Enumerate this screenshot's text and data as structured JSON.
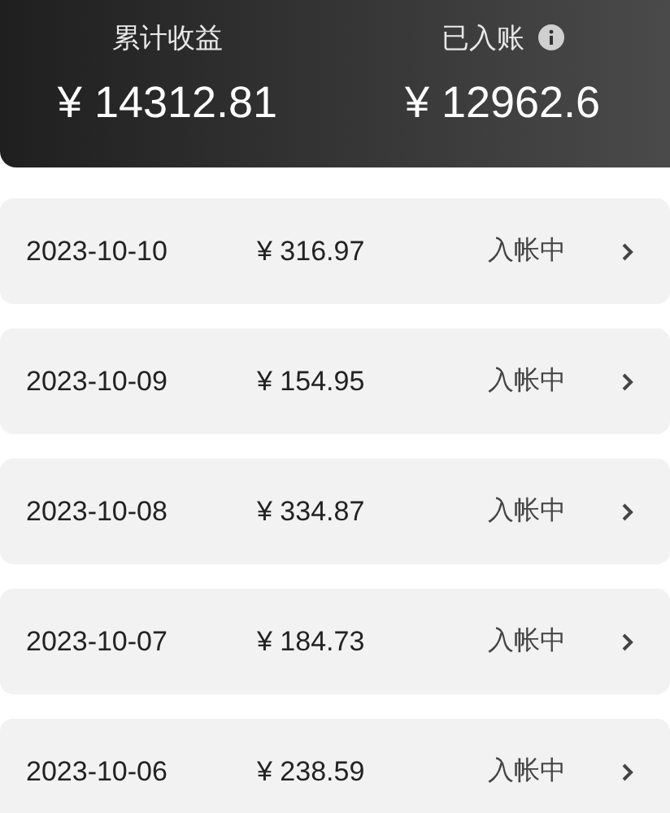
{
  "summary": [
    {
      "label": "累计收益",
      "amount": "¥ 14312.81",
      "info": false
    },
    {
      "label": "已入账",
      "amount": "¥ 12962.6",
      "info": true
    }
  ],
  "records": [
    {
      "date": "2023-10-10",
      "amount": "¥ 316.97",
      "status": "入帐中"
    },
    {
      "date": "2023-10-09",
      "amount": "¥ 154.95",
      "status": "入帐中"
    },
    {
      "date": "2023-10-08",
      "amount": "¥ 334.87",
      "status": "入帐中"
    },
    {
      "date": "2023-10-07",
      "amount": "¥ 184.73",
      "status": "入帐中"
    },
    {
      "date": "2023-10-06",
      "amount": "¥ 238.59",
      "status": "入帐中"
    }
  ]
}
